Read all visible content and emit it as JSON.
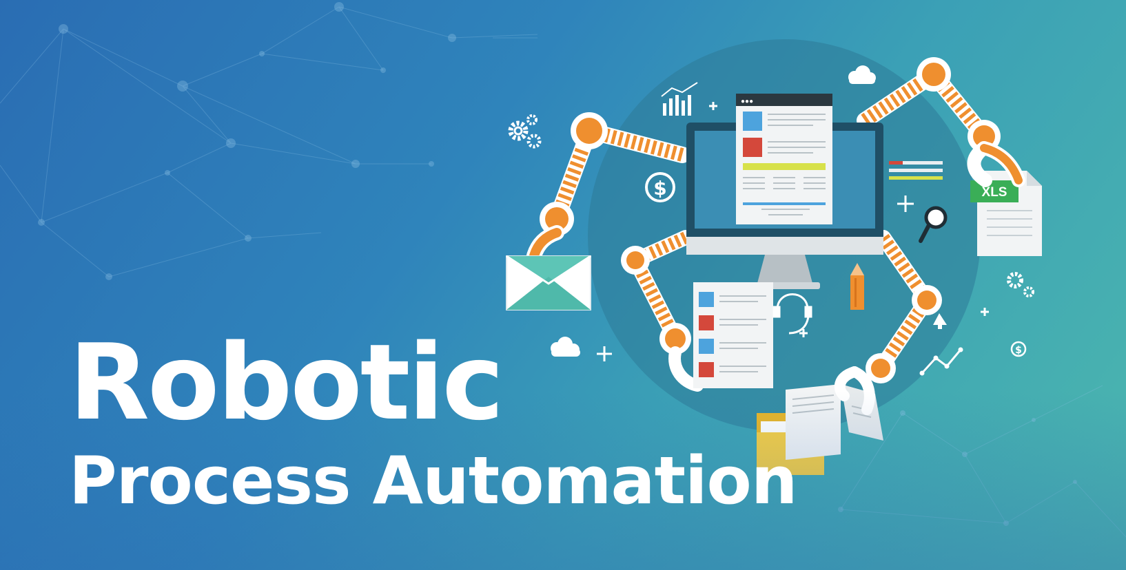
{
  "banner": {
    "title_line_1": "Robotic",
    "title_line_2": "Process Automation",
    "colors": {
      "background_start": "#2a6db3",
      "background_end": "#4cb7ae",
      "robot_arm_orange": "#ef8f2f",
      "circle_backdrop": "#2e7a98",
      "text": "#ffffff"
    }
  },
  "illustration": {
    "xls_badge": "XLS",
    "browser_window_dots": "●●●",
    "icons": [
      "monitor-icon",
      "document-icon",
      "envelope-icon",
      "xls-file-icon",
      "folder-icon",
      "open-book-icon",
      "headset-icon",
      "pencil-icon",
      "magnifier-icon",
      "gears-icon",
      "dollar-icon",
      "bar-chart-icon",
      "line-chart-icon",
      "cloud-icon",
      "plus-icon",
      "cursor-icon"
    ]
  }
}
